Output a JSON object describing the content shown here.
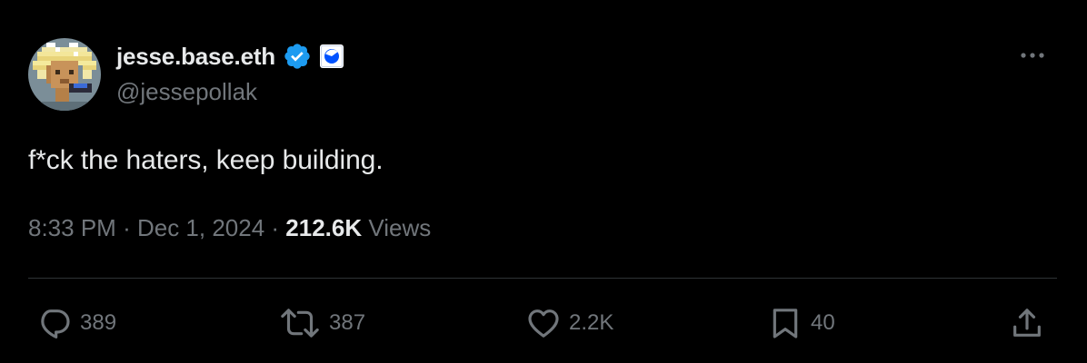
{
  "author": {
    "display_name": "jesse.base.eth",
    "handle": "@jessepollak",
    "verified": true
  },
  "tweet": {
    "text": "f*ck the haters, keep building."
  },
  "meta": {
    "time": "8:33 PM",
    "separator": "·",
    "date": "Dec 1, 2024",
    "views_count": "212.6K",
    "views_label": "Views"
  },
  "actions": {
    "replies": "389",
    "reposts": "387",
    "likes": "2.2K",
    "bookmarks": "40"
  },
  "icons": {
    "more": "more-horizontal-icon",
    "verified": "verified-badge-icon",
    "affiliate": "base-affiliate-badge-icon",
    "reply": "reply-icon",
    "repost": "repost-icon",
    "like": "heart-icon",
    "bookmark": "bookmark-icon",
    "share": "share-icon"
  },
  "colors": {
    "background": "#000000",
    "primary_text": "#e7e9ea",
    "secondary_text": "#71767b",
    "verified_blue": "#1d9bf0",
    "divider": "#2f3336",
    "base_blue": "#0052ff"
  }
}
